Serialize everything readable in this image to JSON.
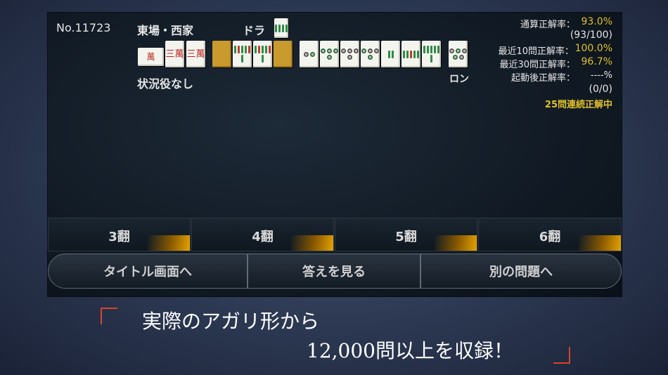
{
  "header": {
    "problem_no": "No.11723",
    "round_seat": "東場・西家",
    "dora_label": "ドラ",
    "situation": "状況役なし",
    "ron": "ロン"
  },
  "stats": {
    "total_label": "通算正解率：",
    "total_value": "93.0%",
    "total_count": "(93/100)",
    "recent10_label": "最近10問正解率：",
    "recent10_value": "100.0%",
    "recent30_label": "最近30問正解率：",
    "recent30_value": "96.7%",
    "since_boot_label": "起動後正解率：",
    "since_boot_value": "----%",
    "since_boot_count": "(0/0)",
    "streak": "25問連続正解中"
  },
  "tiles": {
    "hand_left": [
      "3-man",
      "3-man",
      "3-man"
    ],
    "hand_left_label": "三萬",
    "hand_left_side_label": "萬",
    "dora": "8-sou",
    "hand": [
      "2-pin",
      "4-pin",
      "6-pin",
      "4-pin",
      "2-sou",
      "5-sou",
      "6-sou"
    ],
    "winning": "5-pin"
  },
  "answers": [
    "3翻",
    "4翻",
    "5翻",
    "6翻"
  ],
  "buttons": {
    "title": "タイトル画面へ",
    "answer": "答えを見る",
    "next": "別の問題へ"
  },
  "caption": {
    "line1": "実際のアガリ形から",
    "line2": "12,000問以上を収録！"
  },
  "colors": {
    "accent_gold": "#e0c12a",
    "bracket_red": "#d9442b"
  }
}
